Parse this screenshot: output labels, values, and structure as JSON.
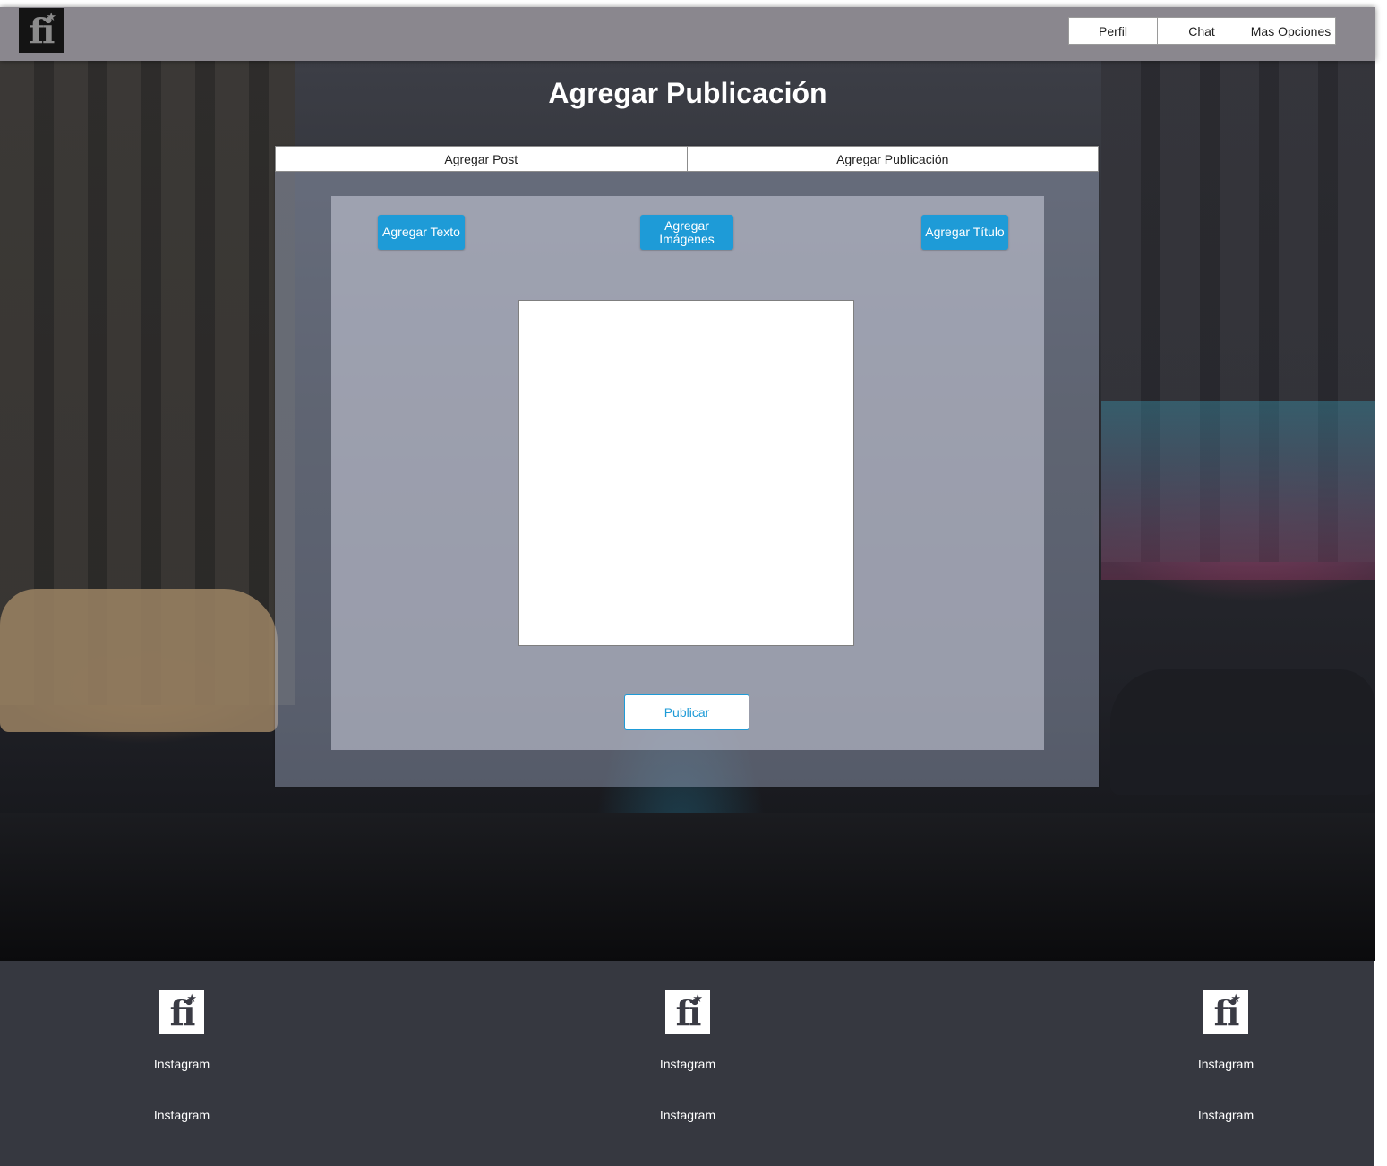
{
  "header": {
    "logo": {
      "text": "fi",
      "star": "★",
      "icon": "fi-logo-icon"
    },
    "nav": [
      {
        "label": "Perfil"
      },
      {
        "label": "Chat"
      },
      {
        "label": "Mas Opciones"
      }
    ]
  },
  "main": {
    "title": "Agregar Publicación",
    "tabs": [
      {
        "label": "Agregar Post"
      },
      {
        "label": "Agregar Publicación"
      }
    ],
    "actions": {
      "add_text": "Agregar Texto",
      "add_images": "Agregar Imágenes",
      "add_title": "Agregar Título"
    },
    "editor_content": "",
    "publish_label": "Publicar"
  },
  "footer": {
    "columns": [
      {
        "logo_text": "fi",
        "logo_star": "★",
        "links": [
          "Instagram",
          "Instagram"
        ]
      },
      {
        "logo_text": "fi",
        "logo_star": "★",
        "links": [
          "Instagram",
          "Instagram"
        ]
      },
      {
        "logo_text": "fi",
        "logo_star": "★",
        "links": [
          "Instagram",
          "Instagram"
        ]
      }
    ]
  },
  "colors": {
    "header_bg": "#8a878e",
    "accent_blue": "#1e9bd7",
    "footer_bg": "#363840"
  }
}
